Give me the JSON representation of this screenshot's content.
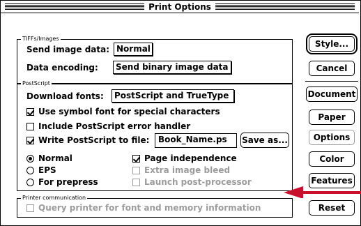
{
  "window": {
    "title": "Print Options"
  },
  "tiffs": {
    "group_label": "TIFFs/Images",
    "send_image_data_label": "Send image data:",
    "send_image_data_value": "Normal",
    "data_encoding_label": "Data encoding:",
    "data_encoding_value": "Send binary image data"
  },
  "postscript": {
    "group_label": "PostScript",
    "download_fonts_label": "Download fonts:",
    "download_fonts_value": "PostScript and TrueType",
    "symbol_font_label": "Use symbol font for special characters",
    "symbol_font_checked": true,
    "error_handler_label": "Include PostScript error handler",
    "error_handler_checked": false,
    "write_to_file_label": "Write PostScript to file:",
    "write_to_file_checked": true,
    "file_name_value": "Book_Name.ps",
    "save_as_label": "Save as...",
    "format_options": [
      "Normal",
      "EPS",
      "For prepress"
    ],
    "format_selected": "Normal",
    "page_independence_label": "Page independence",
    "page_independence_checked": true,
    "extra_bleed_label": "Extra image bleed",
    "launch_post_label": "Launch post-processor"
  },
  "printer_comm": {
    "group_label": "Printer communication",
    "query_label": "Query printer for font and memory information"
  },
  "buttons": {
    "style": "Style...",
    "cancel": "Cancel",
    "document": "Document",
    "paper": "Paper",
    "options": "Options",
    "color": "Color",
    "features": "Features",
    "reset": "Reset"
  },
  "colors": {
    "annotation_arrow": "#c8102e",
    "disabled_text": "#9c9c9c"
  }
}
